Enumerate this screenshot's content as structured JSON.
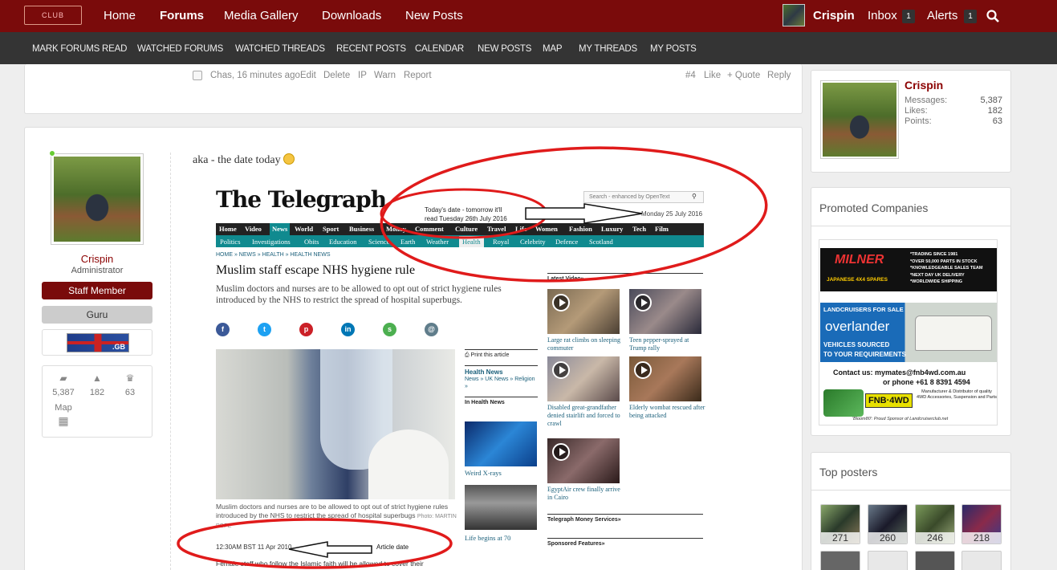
{
  "topnav": {
    "logo_text": "CLUB",
    "items": [
      "Home",
      "Forums",
      "Media Gallery",
      "Downloads",
      "New Posts"
    ],
    "user": "Crispin",
    "inbox": {
      "label": "Inbox",
      "count": "1"
    },
    "alerts": {
      "label": "Alerts",
      "count": "1"
    }
  },
  "subnav": [
    "MARK FORUMS READ",
    "WATCHED FORUMS",
    "WATCHED THREADS",
    "RECENT POSTS",
    "CALENDAR",
    "NEW POSTS",
    "MAP",
    "MY THREADS",
    "MY POSTS"
  ],
  "prev_post": {
    "meta": "Chas, 16 minutes ago",
    "actions": [
      "Edit",
      "Delete",
      "IP",
      "Warn",
      "Report"
    ],
    "number": "#4",
    "right_actions": [
      "Like",
      "+ Quote",
      "Reply"
    ]
  },
  "post": {
    "author": "Crispin",
    "title": "Administrator",
    "role1": "Staff Member",
    "role2": "Guru",
    "flag_text": ".GB",
    "stats": {
      "messages": "5,387",
      "likes": "182",
      "points": "63",
      "map": "Map"
    },
    "message": "aka - the date today",
    "colors": {
      "staff": "#7a0b0b",
      "guru": "#cccccc",
      "annotation": "#e01b1b"
    }
  },
  "screenshot": {
    "logo": "The Telegraph",
    "search": "Search - enhanced by OpenText",
    "note_line1": "Today's date - tomorrow it'll",
    "note_line2": "read Tuesday 26th July 2016",
    "date": "Monday 25 July 2016",
    "nav1": [
      "Home",
      "Video",
      "News",
      "World",
      "Sport",
      "Business",
      "Money",
      "Comment",
      "Culture",
      "Travel",
      "Life",
      "Women",
      "Fashion",
      "Luxury",
      "Tech",
      "Film"
    ],
    "nav2": [
      "Politics",
      "Investigations",
      "Obits",
      "Education",
      "Science",
      "Earth",
      "Weather",
      "Health",
      "Royal",
      "Celebrity",
      "Defence",
      "Scotland"
    ],
    "breadcrumb": "HOME » NEWS » HEALTH » HEALTH NEWS",
    "headline": "Muslim staff escape NHS hygiene rule",
    "standfirst": "Muslim doctors and nurses are to be allowed to opt out of strict hygiene rules introduced by the NHS to restrict the spread of hospital superbugs.",
    "social": [
      "f",
      "t",
      "p",
      "in",
      "s",
      "@"
    ],
    "caption": "Muslim doctors and nurses are to be allowed to opt out of strict hygiene rules introduced by the NHS to restrict the spread of hospital superbugs",
    "photo_credit": "Photo: MARTIN POPE",
    "timestamp": "12:30AM BST 11 Apr 2010",
    "article_label": "Article date",
    "body": "Female staff who follow the Islamic faith will be allowed to cover their",
    "print": "Print this article",
    "health_news": "Health News",
    "news_links": "News » UK News » Religion »",
    "in_health": "In Health News",
    "weird": "Weird X-rays",
    "life": "Life begins at 70",
    "latest_video": "Latest Video»",
    "videos": [
      "Large rat climbs on sleeping commuter",
      "Teen pepper-sprayed at Trump rally",
      "Disabled great-grandfather denied stairlift and forced to crawl",
      "Elderly wombat rescued after being attacked",
      "EgyptAir crew finally arrive in Cairo"
    ],
    "money": "Telegraph Money Services»",
    "sponsored": "Sponsored Features»"
  },
  "sidebar": {
    "name": "Crispin",
    "messages": {
      "label": "Messages:",
      "value": "5,387"
    },
    "likes": {
      "label": "Likes:",
      "value": "182"
    },
    "points": {
      "label": "Points:",
      "value": "63"
    },
    "promoted": "Promoted Companies",
    "ad1": {
      "brand": "MILNER",
      "sub": "JAPANESE 4X4 SPARES",
      "lines": [
        "*TRADING SINCE 1981",
        "*OVER 50,000 PARTS IN STOCK",
        "*KNOWLEDGEABLE SALES TEAM",
        "*NEXT DAY UK DELIVERY",
        "*WORLDWIDE SHIPPING"
      ]
    },
    "ad2": {
      "top": "LANDCRUISERS FOR SALE",
      "brand": "overlander",
      "sub1": "VEHICLES SOURCED",
      "sub2": "TO YOUR REQUIREMENTS"
    },
    "ad3": {
      "contact": "Contact us: mymates@fnb4wd.com.au",
      "phone": "or phone  +61 8 8391 4594",
      "brand": "FNB·4WD",
      "desc": "Manufacturer & Distributor of quality 4WD Accessories, Suspension and Parts",
      "sponsor": "'Bloom80': Proud Sponsor of Landcruiserclub.net"
    },
    "top_posters": "Top posters",
    "poster_counts": [
      "271",
      "260",
      "246",
      "218"
    ]
  }
}
